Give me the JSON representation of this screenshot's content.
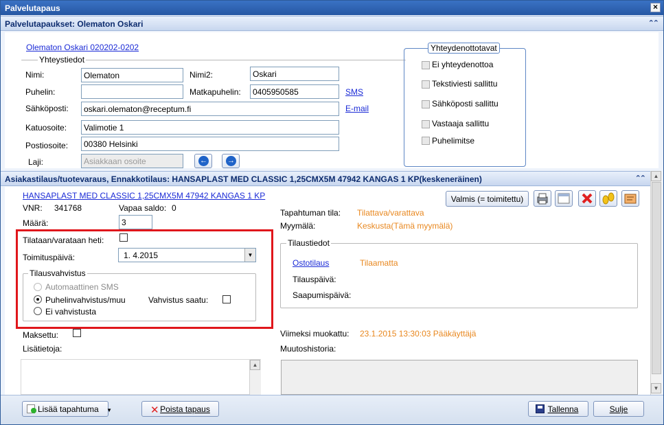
{
  "window": {
    "title": "Palvelutapaus"
  },
  "header": {
    "title": "Palvelutapaukset: Olematon Oskari"
  },
  "customer": {
    "link": "Olematon Oskari   020202-0202",
    "section_title": "Yhteystiedot",
    "first_name_label": "Nimi:",
    "first_name": "Olematon",
    "last_name_label": "Nimi2:",
    "last_name": "Oskari",
    "phone_label": "Puhelin:",
    "phone": "",
    "mobile_label": "Matkapuhelin:",
    "mobile": "0405950585",
    "sms_link": "SMS",
    "email_label": "Sähköposti:",
    "email": "oskari.olematon@receptum.fi",
    "email_link": "E-mail",
    "street_label": "Katuosoite:",
    "street": "Valimotie 1",
    "postal_label": "Postiosoite:",
    "postal": "00380 Helsinki",
    "type_label": "Laji:",
    "type": "Asiakkaan osoite"
  },
  "contact_methods": {
    "title": "Yhteydenottotavat",
    "options": [
      "Ei yhteydenottoa",
      "Tekstiviesti sallittu",
      "Sähköposti sallittu",
      "Vastaaja sallittu",
      "Puhelimitse"
    ]
  },
  "order": {
    "header": "Asiakastilaus/tuotevaraus, Ennakkotilaus:  HANSAPLAST MED CLASSIC 1,25CMX5M 47942 KANGAS 1 KP(keskeneräinen)",
    "product_link": "HANSAPLAST MED CLASSIC 1,25CMX5M 47942 KANGAS 1 KP",
    "vnr_label": "VNR:",
    "vnr": "341768",
    "free_balance_label": "Vapaa saldo:",
    "free_balance": "0",
    "quantity_label": "Määrä:",
    "quantity": "3",
    "order_now_label": "Tilataan/varataan heti:",
    "delivery_label": "Toimituspäivä:",
    "delivery_date": "1.  4.2015",
    "confirmation_title": "Tilausvahvistus",
    "conf_auto_sms": "Automaattinen SMS",
    "conf_phone": "Puhelinvahvistus/muu",
    "conf_received_label": "Vahvistus saatu:",
    "conf_none": "Ei vahvistusta",
    "paid_label": "Maksettu:",
    "notes_label": "Lisätietoja:",
    "done_button": "Valmis (= toimitettu)",
    "status_label": "Tapahtuman tila:",
    "status": "Tilattava/varattava",
    "store_label": "Myymälä:",
    "store": "Keskusta(Tämä myymälä)",
    "order_info_title": "Tilaustiedot",
    "purchase_order_link": "Ostotilaus",
    "purchase_order_status": "Tilaamatta",
    "order_date_label": "Tilauspäivä:",
    "arrival_date_label": "Saapumispäivä:",
    "modified_label": "Viimeksi muokattu:",
    "modified": "23.1.2015 13:30:03 Pääkäyttäjä",
    "history_label": "Muutoshistoria:"
  },
  "footer": {
    "add_event": "Lisää tapahtuma",
    "delete_case": "Poista tapaus",
    "save": "Tallenna",
    "close": "Sulje"
  },
  "colors": {
    "accent": "#e8871e",
    "highlight_border": "#e0161b",
    "link": "#1a2ad6"
  }
}
